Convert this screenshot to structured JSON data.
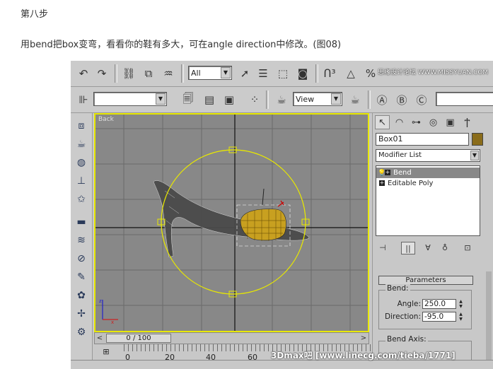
{
  "article": {
    "step_title": "第八步",
    "paragraph": "用bend把box变弯，看看你的鞋有多大，可在angle direction中修改。(图08)"
  },
  "toolbar": {
    "selection_filter": "All",
    "coord_system": "View"
  },
  "viewport": {
    "label": "Back"
  },
  "timeline": {
    "slider_text": "0 / 100",
    "ticks": [
      "0",
      "20",
      "40",
      "60"
    ]
  },
  "panel": {
    "object_name": "Box01",
    "object_color": "#8a6c1a",
    "modifier_list_label": "Modifier List",
    "stack": [
      {
        "label": "Bend",
        "selected": true
      },
      {
        "label": "Editable Poly",
        "selected": false
      }
    ],
    "parameters_title": "Parameters",
    "bend_group": "Bend:",
    "angle_label": "Angle:",
    "angle_value": "250.0",
    "direction_label": "Direction:",
    "direction_value": "-95.0",
    "bend_axis_group": "Bend Axis:"
  },
  "watermarks": {
    "top": "思缘设计论坛 WWW.MISSYUAN.COM",
    "bottom": "3Dmax吧 [www.linecg.com/tieba/1771]"
  },
  "colors": {
    "selection_yellow": "#e8e800",
    "viewport_bg": "#888888"
  }
}
